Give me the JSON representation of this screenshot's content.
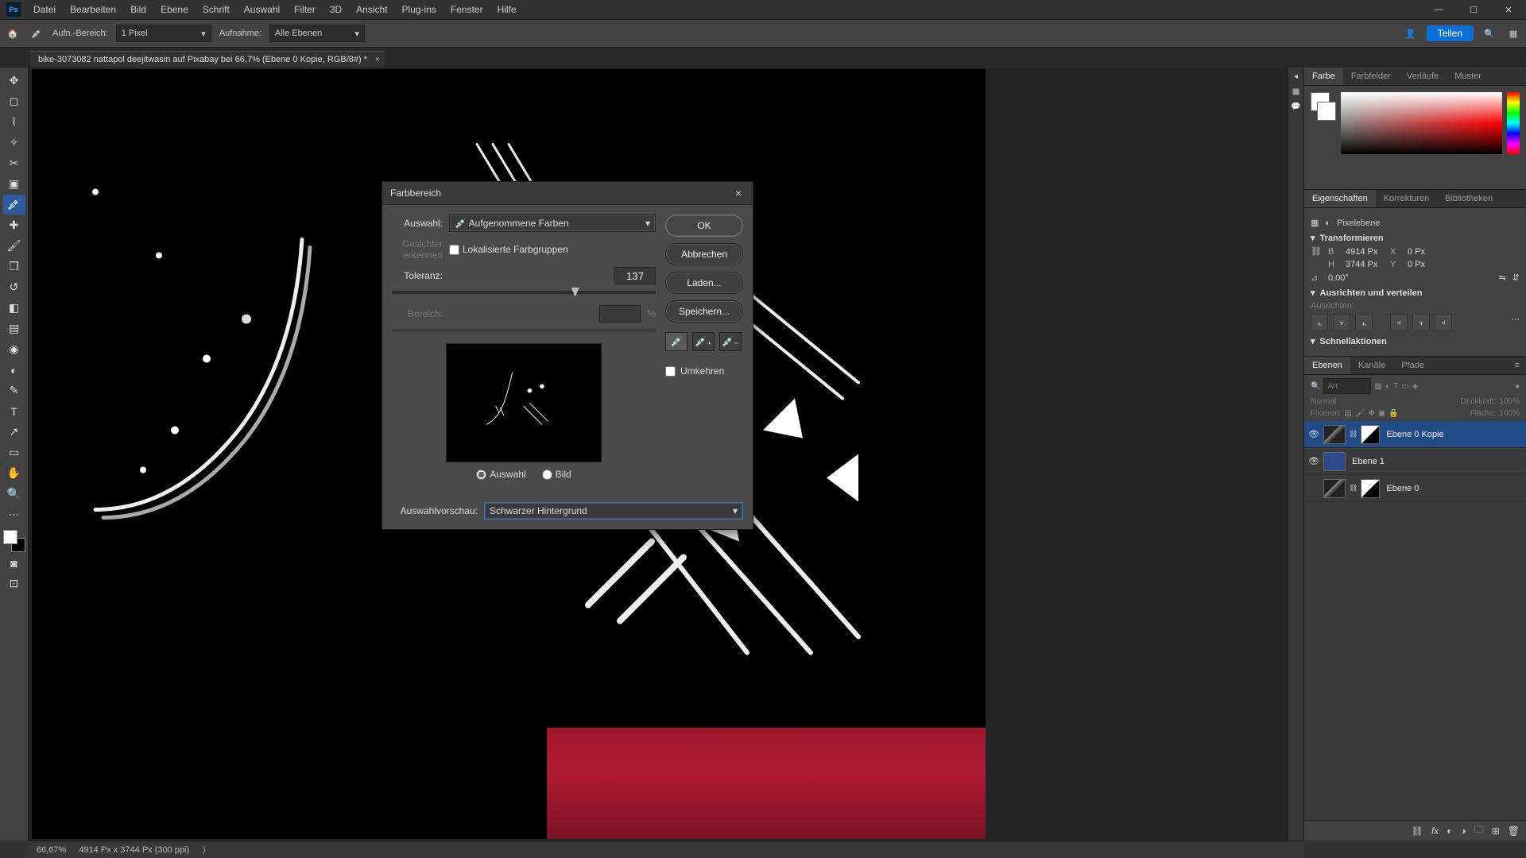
{
  "menu": {
    "items": [
      "Datei",
      "Bearbeiten",
      "Bild",
      "Ebene",
      "Schrift",
      "Auswahl",
      "Filter",
      "3D",
      "Ansicht",
      "Plug-ins",
      "Fenster",
      "Hilfe"
    ]
  },
  "optionsbar": {
    "sample_area_label": "Aufn.-Bereich:",
    "sample_area_value": "1 Pixel",
    "sample_label": "Aufnahme:",
    "sample_value": "Alle Ebenen",
    "share": "Teilen"
  },
  "tab": {
    "title": "bike-3073082 nattapol deejitwasin auf Pixabay bei 66,7% (Ebene 0 Kopie, RGB/8#) *"
  },
  "dialog": {
    "title": "Farbbereich",
    "auswahl_label": "Auswahl:",
    "auswahl_value": "Aufgenommene Farben",
    "faces": "Gesichter erkennen",
    "localized": "Lokalisierte Farbgruppen",
    "tolerance_label": "Toleranz:",
    "tolerance_value": "137",
    "range_label": "Bereich:",
    "range_unit": "%",
    "radio_selection": "Auswahl",
    "radio_image": "Bild",
    "preview_label": "Auswahlvorschau:",
    "preview_value": "Schwarzer Hintergrund",
    "ok": "OK",
    "cancel": "Abbrechen",
    "load": "Laden...",
    "save": "Speichern...",
    "invert": "Umkehren"
  },
  "panels": {
    "color_tabs": [
      "Farbe",
      "Farbfelder",
      "Verläufe",
      "Muster"
    ],
    "prop_tabs": [
      "Eigenschaften",
      "Korrekturen",
      "Bibliotheken"
    ],
    "prop_type_label": "Pixelebene",
    "transform_hdr": "Transformieren",
    "w_lbl": "B",
    "w_val": "4914 Px",
    "h_lbl": "H",
    "h_val": "3744 Px",
    "x_lbl": "X",
    "x_val": "0 Px",
    "y_lbl": "Y",
    "y_val": "0 Px",
    "angle_lbl": "⊿",
    "angle_val": "0,00°",
    "align_hdr": "Ausrichten und verteilen",
    "align_sub": "Ausrichten:",
    "quick_hdr": "Schnellaktionen",
    "layer_tabs": [
      "Ebenen",
      "Kanäle",
      "Pfade"
    ],
    "search_placeholder": "Art",
    "blend_mode": "Normal",
    "opacity_label": "Deckkraft:",
    "opacity_value": "100%",
    "lock_label": "Fixieren:",
    "fill_label": "Fläche:",
    "fill_value": "100%",
    "layers": [
      {
        "visible": true,
        "name": "Ebene 0 Kopie",
        "hasMask": true,
        "selected": true,
        "thumb": "img"
      },
      {
        "visible": true,
        "name": "Ebene 1",
        "hasMask": false,
        "selected": false,
        "thumb": "blue"
      },
      {
        "visible": false,
        "name": "Ebene 0",
        "hasMask": true,
        "selected": false,
        "thumb": "img"
      }
    ]
  },
  "status": {
    "zoom": "66,67%",
    "info": "4914 Px x 3744 Px (300 ppi)"
  }
}
